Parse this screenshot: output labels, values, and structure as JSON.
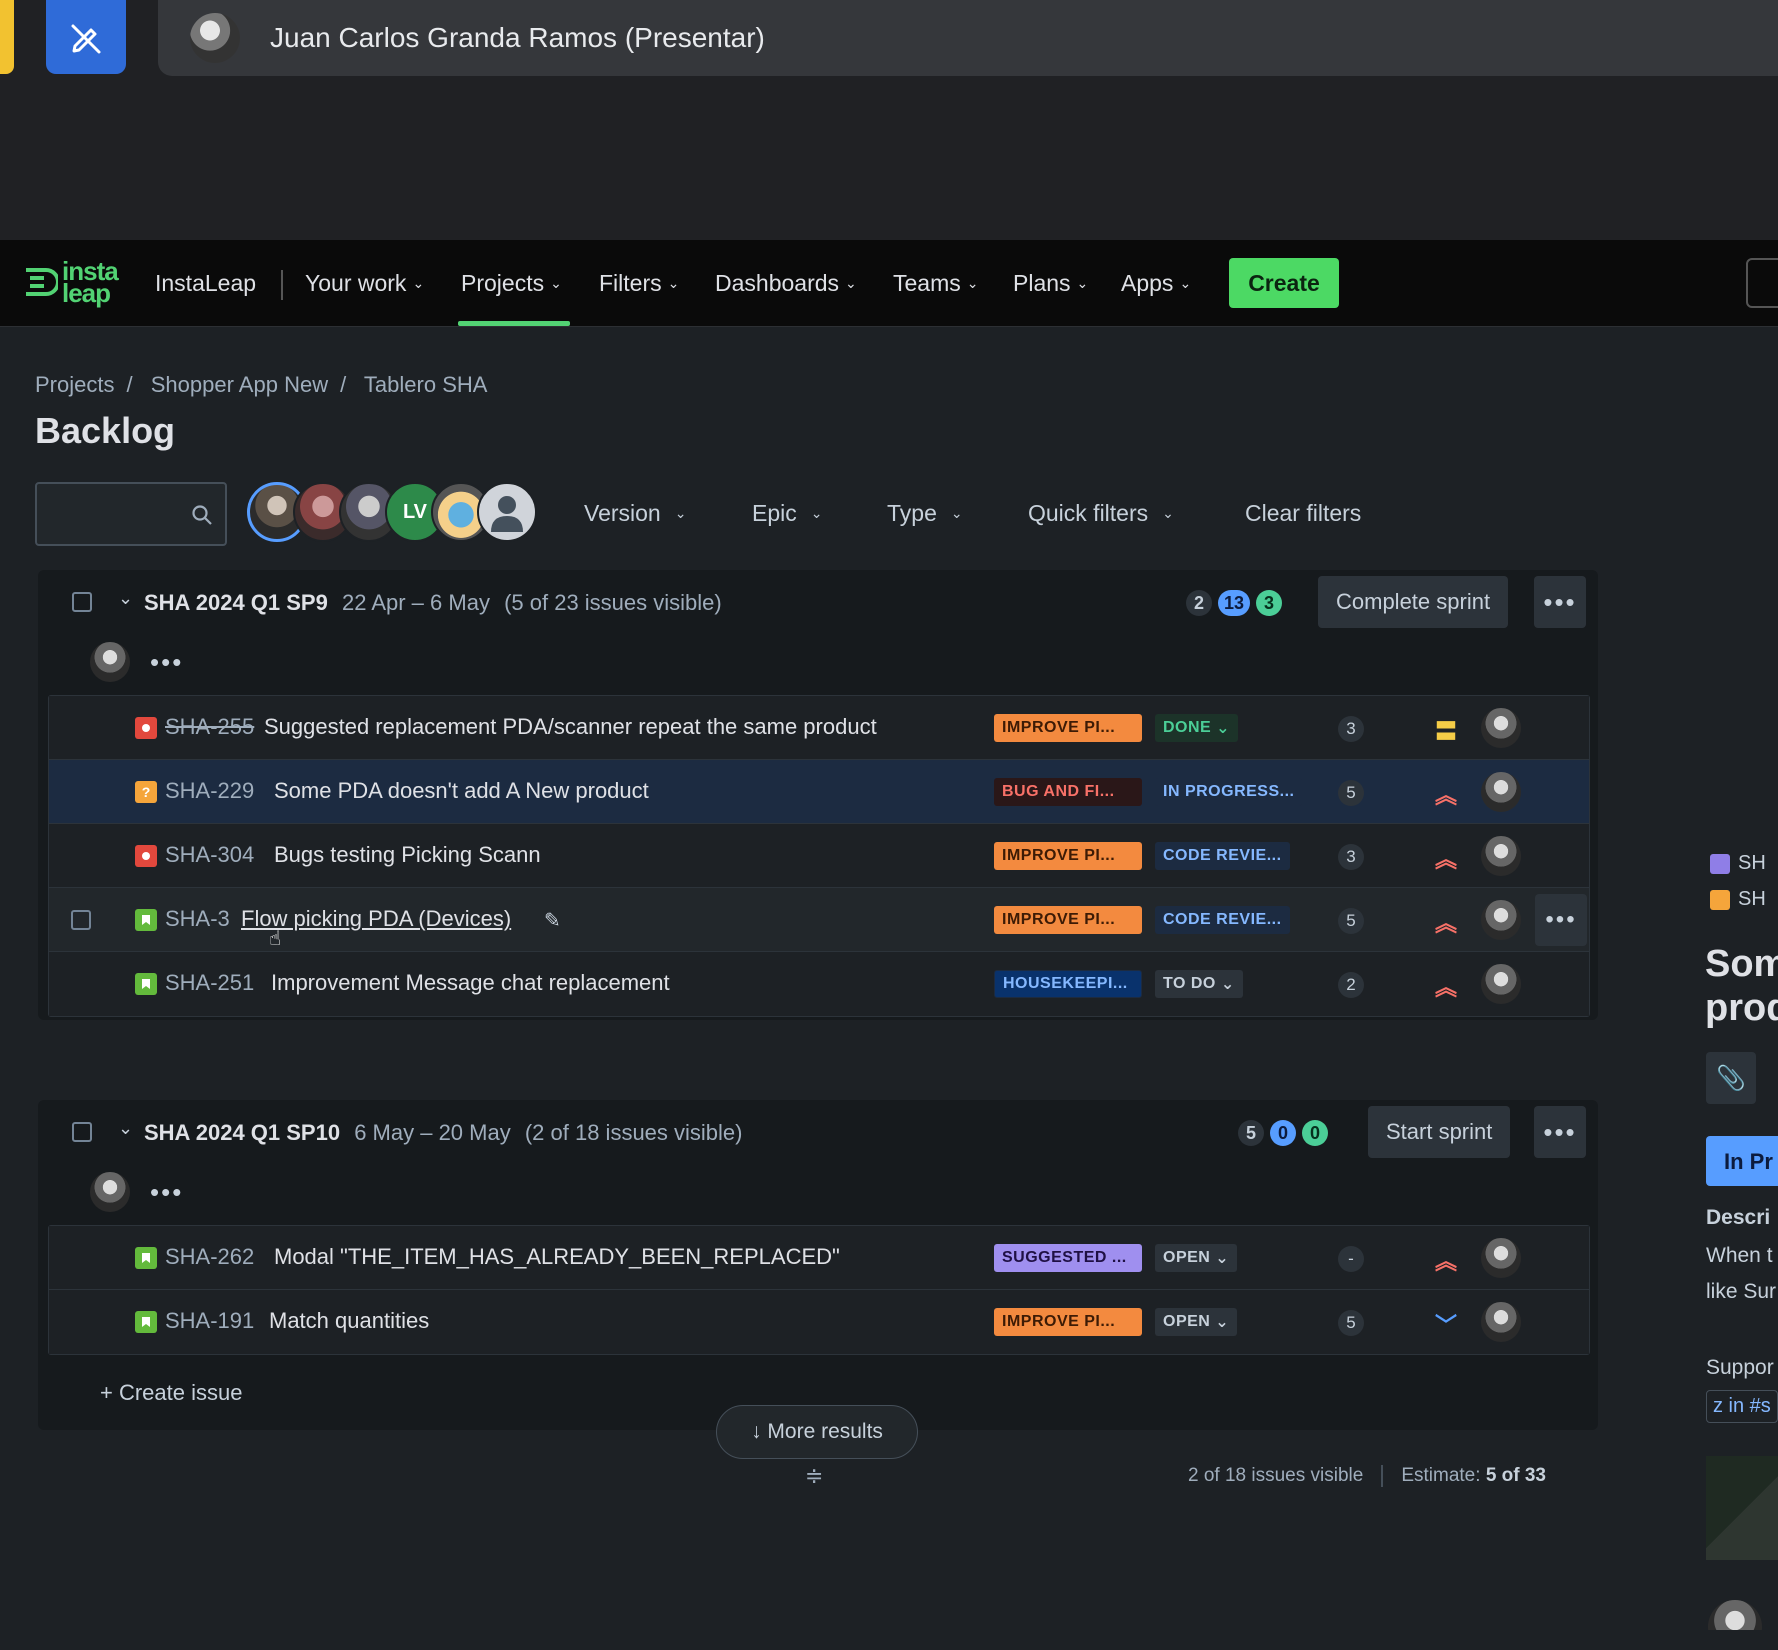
{
  "meet": {
    "presenter_name": "Juan Carlos Granda Ramos (Presentar)",
    "annotate_icon": "pen-slash-icon"
  },
  "nav": {
    "logo_text": "insta leap",
    "workspace": "InstaLeap",
    "items": [
      "Your work",
      "Projects",
      "Filters",
      "Dashboards",
      "Teams",
      "Plans",
      "Apps"
    ],
    "active": "Projects",
    "create_label": "Create",
    "accent": "#52d273"
  },
  "breadcrumb": [
    "Projects",
    "Shopper App New",
    "Tablero SHA"
  ],
  "page_title": "Backlog",
  "filters": {
    "search_placeholder": "",
    "avatar_initials": "LV",
    "dropdowns": [
      "Version",
      "Epic",
      "Type",
      "Quick filters"
    ],
    "clear_label": "Clear filters"
  },
  "sprints": [
    {
      "name": "SHA 2024 Q1 SP9",
      "dates": "22 Apr – 6 May",
      "visible": "(5 of 23 issues visible)",
      "counts": [
        "2",
        "13",
        "3"
      ],
      "action": "Complete sprint",
      "issues": [
        {
          "key": "SHA-255",
          "summary": "Suggested replacement PDA/scanner repeat the same product",
          "type": "bug",
          "epic": "IMPROVE PI...",
          "status": "DONE",
          "points": "3",
          "priority": "medium"
        },
        {
          "key": "SHA-229",
          "summary": "Some PDA doesn't add A New product",
          "type": "question",
          "epic": "BUG AND FI...",
          "status": "IN PROGRESS...",
          "points": "5",
          "priority": "high"
        },
        {
          "key": "SHA-304",
          "summary": "Bugs testing Picking Scann",
          "type": "bug",
          "epic": "IMPROVE PI...",
          "status": "CODE REVIE...",
          "points": "3",
          "priority": "high"
        },
        {
          "key": "SHA-3",
          "summary": "Flow picking PDA (Devices)",
          "type": "story",
          "epic": "IMPROVE PI...",
          "status": "CODE REVIE...",
          "points": "5",
          "priority": "high"
        },
        {
          "key": "SHA-251",
          "summary": "Improvement Message chat replacement",
          "type": "story",
          "epic": "HOUSEKEEPI...",
          "status": "TO DO",
          "points": "2",
          "priority": "high"
        }
      ]
    },
    {
      "name": "SHA 2024 Q1 SP10",
      "dates": "6 May – 20 May",
      "visible": "(2 of 18 issues visible)",
      "counts": [
        "5",
        "0",
        "0"
      ],
      "action": "Start sprint",
      "issues": [
        {
          "key": "SHA-262",
          "summary": "Modal \"THE_ITEM_HAS_ALREADY_BEEN_REPLACED\"",
          "type": "story",
          "epic": "SUGGESTED ...",
          "status": "OPEN",
          "points": "-",
          "priority": "high"
        },
        {
          "key": "SHA-191",
          "summary": "Match quantities",
          "type": "story",
          "epic": "IMPROVE PI...",
          "status": "OPEN",
          "points": "5",
          "priority": "low"
        }
      ]
    }
  ],
  "create_issue": "Create issue",
  "more_results": "More results",
  "footer": {
    "visible": "2 of 18 issues visible",
    "estimate_label": "Estimate:",
    "estimate_value": "5 of 33"
  },
  "side_panel": {
    "line1": "SH",
    "line2": "SH",
    "title_1": "Som",
    "title_2": "prod",
    "status": "In Pr",
    "desc_label": "Descri",
    "desc_1": "When t",
    "desc_2": "like Sur",
    "support": "Suppor",
    "link": "z in #s"
  }
}
